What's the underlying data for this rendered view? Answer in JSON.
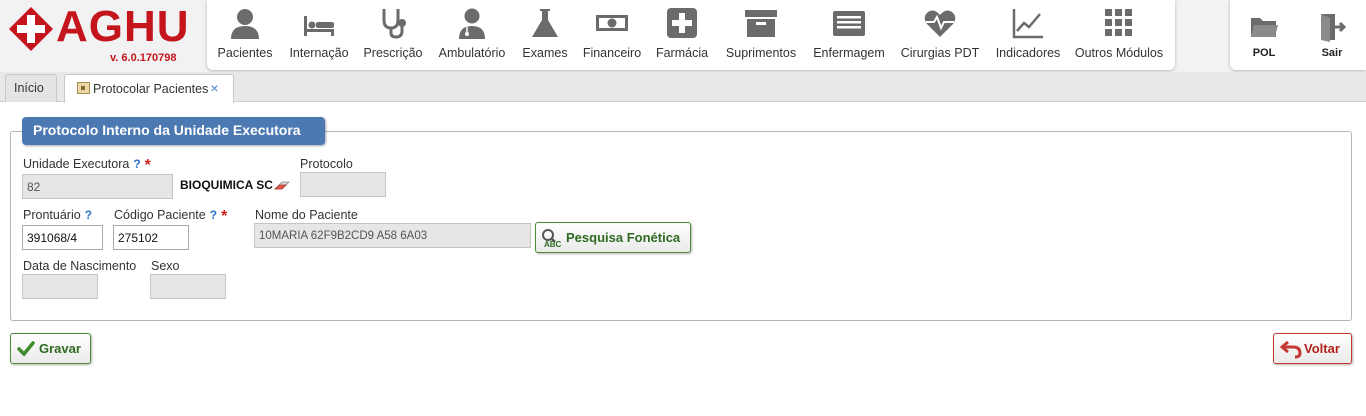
{
  "app": {
    "logo_text": "AGHU",
    "version": "v. 6.0.170798"
  },
  "modules": [
    {
      "label": "Pacientes",
      "icon": "person-icon"
    },
    {
      "label": "Internação",
      "icon": "bed-icon"
    },
    {
      "label": "Prescrição",
      "icon": "stethoscope-icon"
    },
    {
      "label": "Ambulatório",
      "icon": "doctor-icon"
    },
    {
      "label": "Exames",
      "icon": "flask-icon"
    },
    {
      "label": "Financeiro",
      "icon": "money-icon"
    },
    {
      "label": "Farmácia",
      "icon": "medical-cross-icon"
    },
    {
      "label": "Suprimentos",
      "icon": "archive-box-icon"
    },
    {
      "label": "Enfermagem",
      "icon": "list-panel-icon"
    },
    {
      "label": "Cirurgias PDT",
      "icon": "heartbeat-icon"
    },
    {
      "label": "Indicadores",
      "icon": "line-chart-icon"
    },
    {
      "label": "Outros Módulos",
      "icon": "grid-icon"
    }
  ],
  "right_modules": [
    {
      "label": "POL",
      "icon": "folder-icon"
    },
    {
      "label": "Sair",
      "icon": "exit-door-icon"
    }
  ],
  "tabs": [
    {
      "label": "Início",
      "active": false
    },
    {
      "label": "Protocolar Pacientes",
      "active": true,
      "close": "×"
    }
  ],
  "form": {
    "title": "Protocolo Interno da Unidade Executora",
    "unidade_executora": {
      "label": "Unidade Executora",
      "help": "?",
      "required": "*",
      "value": "82",
      "description": "BIOQUIMICA SC"
    },
    "protocolo": {
      "label": "Protocolo",
      "value": ""
    },
    "prontuario": {
      "label": "Prontuário",
      "help": "?",
      "value": "391068/4"
    },
    "codigo_paciente": {
      "label": "Código Paciente",
      "help": "?",
      "required": "*",
      "value": "275102"
    },
    "nome_paciente": {
      "label": "Nome do Paciente",
      "value": "10MARIA 62F9B2CD9 A58 6A03"
    },
    "pesquisa_fonetica": {
      "label": "Pesquisa Fonética",
      "icon_text": "ABC"
    },
    "data_nascimento": {
      "label": "Data de Nascimento",
      "value": ""
    },
    "sexo": {
      "label": "Sexo",
      "value": ""
    }
  },
  "actions": {
    "gravar": "Gravar",
    "voltar": "Voltar"
  },
  "colors": {
    "brand_red": "#c4151c",
    "panel_title_blue": "#4d79b3",
    "icon_gray": "#6b6b6b",
    "ok_green": "#2e6a21",
    "back_red": "#b3221b"
  }
}
